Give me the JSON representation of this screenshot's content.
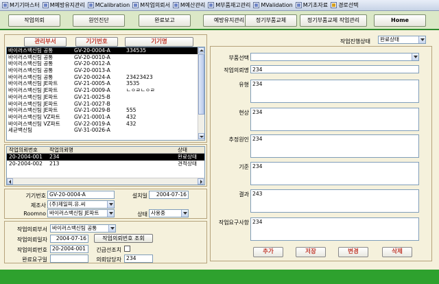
{
  "menu": [
    {
      "label": "M기기마스터"
    },
    {
      "label": "M예방유지관리"
    },
    {
      "label": "MCalibration"
    },
    {
      "label": "M작업의뢰서"
    },
    {
      "label": "M예산관리"
    },
    {
      "label": "M부품재고관리"
    },
    {
      "label": "MValidation"
    },
    {
      "label": "M기초자료"
    },
    {
      "label": "경로선택"
    }
  ],
  "toolbar": [
    {
      "label": "작업의뢰"
    },
    {
      "label": "원인진단"
    },
    {
      "label": "완료보고"
    },
    {
      "label": "예방유지관리"
    },
    {
      "label": "정기부품교체"
    },
    {
      "label": "정기부품교체 작업관리"
    },
    {
      "label": "Home"
    }
  ],
  "left": {
    "headers": {
      "dept": "관리부서",
      "equip_no": "기기번호",
      "equip_name": "기기명"
    },
    "equipment": [
      {
        "dept": "바이러스백신팀 공통",
        "no": "GV-20-0004-A",
        "name": "334535"
      },
      {
        "dept": "바이러스백신팀 공통",
        "no": "GV-20-0010-A",
        "name": ""
      },
      {
        "dept": "바이러스백신팀 공통",
        "no": "GV-20-0012-A",
        "name": ""
      },
      {
        "dept": "바이러스백신팀 공통",
        "no": "GV-20-0013-A",
        "name": ""
      },
      {
        "dept": "바이러스백신팀 공통",
        "no": "GV-20-0024-A",
        "name": "23423423"
      },
      {
        "dept": "바이러스백신팀 JE파트",
        "no": "GV-21-0005-A",
        "name": "3535"
      },
      {
        "dept": "바이러스백신팀 JE파트",
        "no": "GV-21-0009-A",
        "name": "ㄴㅇㄹㄴㅇㄹ"
      },
      {
        "dept": "바이러스백신팀 JE파트",
        "no": "GV-21-0025-B",
        "name": ""
      },
      {
        "dept": "바이러스백신팀 JE파트",
        "no": "GV-21-0027-B",
        "name": ""
      },
      {
        "dept": "바이러스백신팀 JE파트",
        "no": "GV-21-0029-B",
        "name": "555"
      },
      {
        "dept": "바이러스백신팀 VZ파트",
        "no": "GV-21-0001-A",
        "name": "432"
      },
      {
        "dept": "바이러스백신팀 VZ파트",
        "no": "GV-22-0019-A",
        "name": "432"
      },
      {
        "dept": "세균백신팀",
        "no": "GV-31-0026-A",
        "name": ""
      }
    ],
    "requests_headers": {
      "req_no": "작업의뢰번호",
      "req_name": "작업의뢰명",
      "status": "상태"
    },
    "requests": [
      {
        "no": "20-2004-001",
        "name": "234",
        "status": "완료상태"
      },
      {
        "no": "20-2004-002",
        "name": "213",
        "status": "견적상태"
      }
    ],
    "equip_info": {
      "equip_no_label": "기기번호",
      "equip_no": "GV-20-0004-A",
      "install_label": "설치일",
      "install_date": "2004-07-16",
      "maker_label": "제조사",
      "maker": "(주)제일피.유.씨",
      "roomno_label": "Roomno",
      "roomno": "바이러스백신팀 JE파트",
      "status_label": "상태",
      "status": "사용중"
    },
    "request_info": {
      "dept_label": "작업의뢰부서",
      "dept": "바이러스백신팀 공통",
      "date_label": "작업의뢰일자",
      "date": "2004-07-16",
      "lookup_button": "작업의뢰번호 조회",
      "no_label": "작업의뢰번호",
      "no": "20-2004-001",
      "urgent_label": "긴급선조치",
      "due_label": "완료요구일",
      "owner_label": "의뢰담당자",
      "owner": "234"
    }
  },
  "right": {
    "progress_label": "작업진행상태",
    "progress_value": "완료상태",
    "part_label": "부품선택",
    "fields": [
      {
        "label": "작업의뢰명",
        "value": "234"
      },
      {
        "label": "유형",
        "value": "234"
      },
      {
        "label": "현상",
        "value": "234"
      },
      {
        "label": "추정원인",
        "value": "234"
      },
      {
        "label": "기준",
        "value": "234"
      },
      {
        "label": "결과",
        "value": "243"
      },
      {
        "label": "작업요구사항",
        "value": "234"
      }
    ],
    "buttons": {
      "add": "추가",
      "save": "저장",
      "edit": "변경",
      "delete": "삭제"
    }
  },
  "colors": {
    "accent_green": "#2ea12e",
    "button_red": "#c0392b",
    "panel_bg": "#f5f1dc"
  }
}
